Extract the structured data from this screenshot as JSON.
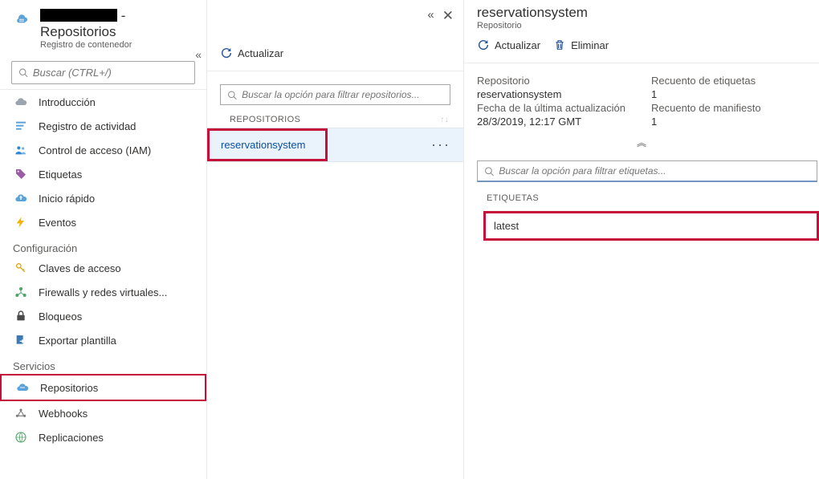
{
  "header": {
    "title_suffix": " - Repositorios",
    "subtitle": "Registro de contenedor"
  },
  "nav": {
    "search_placeholder": "Buscar (CTRL+/)",
    "items": [
      {
        "label": "Introducción"
      },
      {
        "label": "Registro de actividad"
      },
      {
        "label": "Control de acceso (IAM)"
      },
      {
        "label": "Etiquetas"
      },
      {
        "label": "Inicio rápido"
      },
      {
        "label": "Eventos"
      }
    ],
    "section_config": "Configuración",
    "config_items": [
      {
        "label": "Claves de acceso"
      },
      {
        "label": "Firewalls y redes virtuales..."
      },
      {
        "label": "Bloqueos"
      },
      {
        "label": "Exportar plantilla"
      }
    ],
    "section_services": "Servicios",
    "service_items": [
      {
        "label": "Repositorios"
      },
      {
        "label": "Webhooks"
      },
      {
        "label": "Replicaciones"
      }
    ]
  },
  "mid": {
    "refresh": "Actualizar",
    "filter_placeholder": "Buscar la opción para filtrar repositorios...",
    "col_label": "REPOSITORIOS",
    "rows": [
      "reservationsystem"
    ]
  },
  "right": {
    "title": "reservationsystem",
    "subtitle": "Repositorio",
    "refresh": "Actualizar",
    "delete": "Eliminar",
    "repo_label": "Repositorio",
    "repo_value": "reservationsystem",
    "tagcount_label": "Recuento de etiquetas",
    "tagcount_value": "1",
    "updated_label": "Fecha de la última actualización",
    "updated_value": "28/3/2019, 12:17 GMT",
    "manifest_label": "Recuento de manifiesto",
    "manifest_value": "1",
    "filter_placeholder": "Buscar la opción para filtrar etiquetas...",
    "tags_header": "ETIQUETAS",
    "tags": [
      "latest"
    ]
  }
}
